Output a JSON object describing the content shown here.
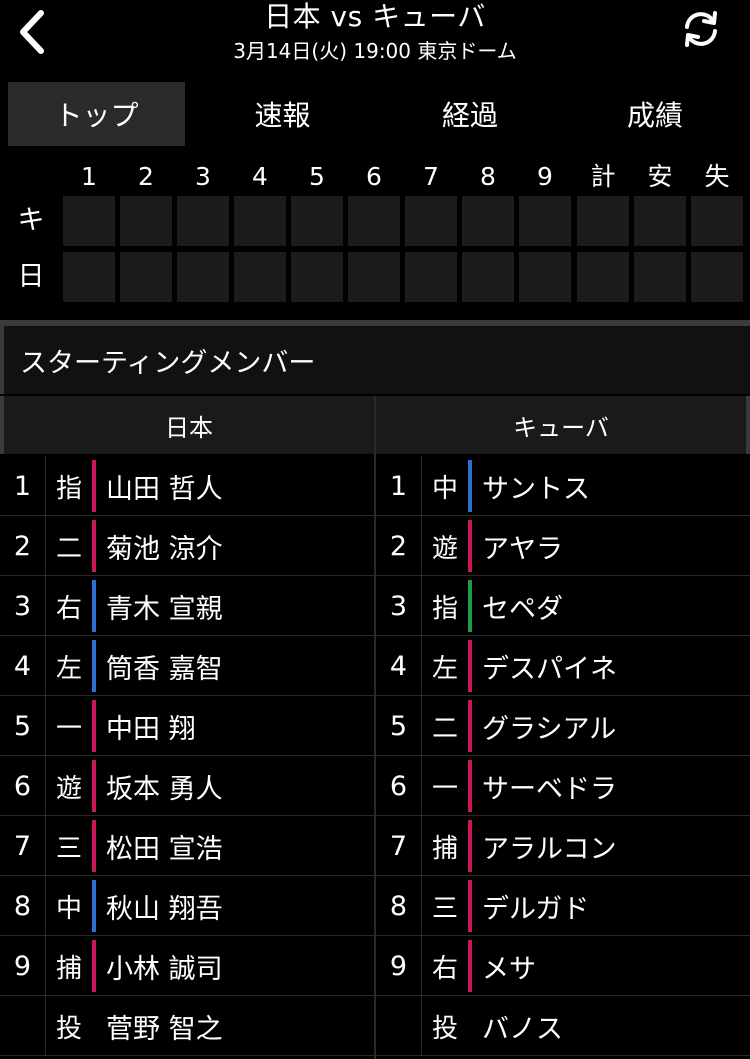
{
  "header": {
    "title": "日本 vs キューバ",
    "subtitle": "3月14日(火) 19:00 東京ドーム"
  },
  "tabs": [
    {
      "label": "トップ",
      "active": true
    },
    {
      "label": "速報",
      "active": false
    },
    {
      "label": "経過",
      "active": false
    },
    {
      "label": "成績",
      "active": false
    }
  ],
  "scoreboard": {
    "columns": [
      "1",
      "2",
      "3",
      "4",
      "5",
      "6",
      "7",
      "8",
      "9",
      "計",
      "安",
      "失"
    ],
    "teams": [
      "キ",
      "日"
    ]
  },
  "section_title": "スターティングメンバー",
  "teams": {
    "home": {
      "name": "日本",
      "lineup": [
        {
          "order": "1",
          "pos": "指",
          "name": "山田 哲人",
          "bar": "#c8175d"
        },
        {
          "order": "2",
          "pos": "二",
          "name": "菊池 涼介",
          "bar": "#c8175d"
        },
        {
          "order": "3",
          "pos": "右",
          "name": "青木 宣親",
          "bar": "#2f6fd1"
        },
        {
          "order": "4",
          "pos": "左",
          "name": "筒香 嘉智",
          "bar": "#2f6fd1"
        },
        {
          "order": "5",
          "pos": "一",
          "name": "中田 翔",
          "bar": "#c8175d"
        },
        {
          "order": "6",
          "pos": "遊",
          "name": "坂本 勇人",
          "bar": "#c8175d"
        },
        {
          "order": "7",
          "pos": "三",
          "name": "松田 宣浩",
          "bar": "#c8175d"
        },
        {
          "order": "8",
          "pos": "中",
          "name": "秋山 翔吾",
          "bar": "#2f6fd1"
        },
        {
          "order": "9",
          "pos": "捕",
          "name": "小林 誠司",
          "bar": "#c8175d"
        },
        {
          "order": "",
          "pos": "投",
          "name": "菅野 智之",
          "bar": ""
        }
      ]
    },
    "away": {
      "name": "キューバ",
      "lineup": [
        {
          "order": "1",
          "pos": "中",
          "name": "サントス",
          "bar": "#2f6fd1"
        },
        {
          "order": "2",
          "pos": "遊",
          "name": "アヤラ",
          "bar": "#c8175d"
        },
        {
          "order": "3",
          "pos": "指",
          "name": "セペダ",
          "bar": "#1f9a45"
        },
        {
          "order": "4",
          "pos": "左",
          "name": "デスパイネ",
          "bar": "#c8175d"
        },
        {
          "order": "5",
          "pos": "二",
          "name": "グラシアル",
          "bar": "#c8175d"
        },
        {
          "order": "6",
          "pos": "一",
          "name": "サーベドラ",
          "bar": "#c8175d"
        },
        {
          "order": "7",
          "pos": "捕",
          "name": "アラルコン",
          "bar": "#c8175d"
        },
        {
          "order": "8",
          "pos": "三",
          "name": "デルガド",
          "bar": "#c8175d"
        },
        {
          "order": "9",
          "pos": "右",
          "name": "メサ",
          "bar": "#c8175d"
        },
        {
          "order": "",
          "pos": "投",
          "name": "バノス",
          "bar": ""
        }
      ]
    }
  }
}
